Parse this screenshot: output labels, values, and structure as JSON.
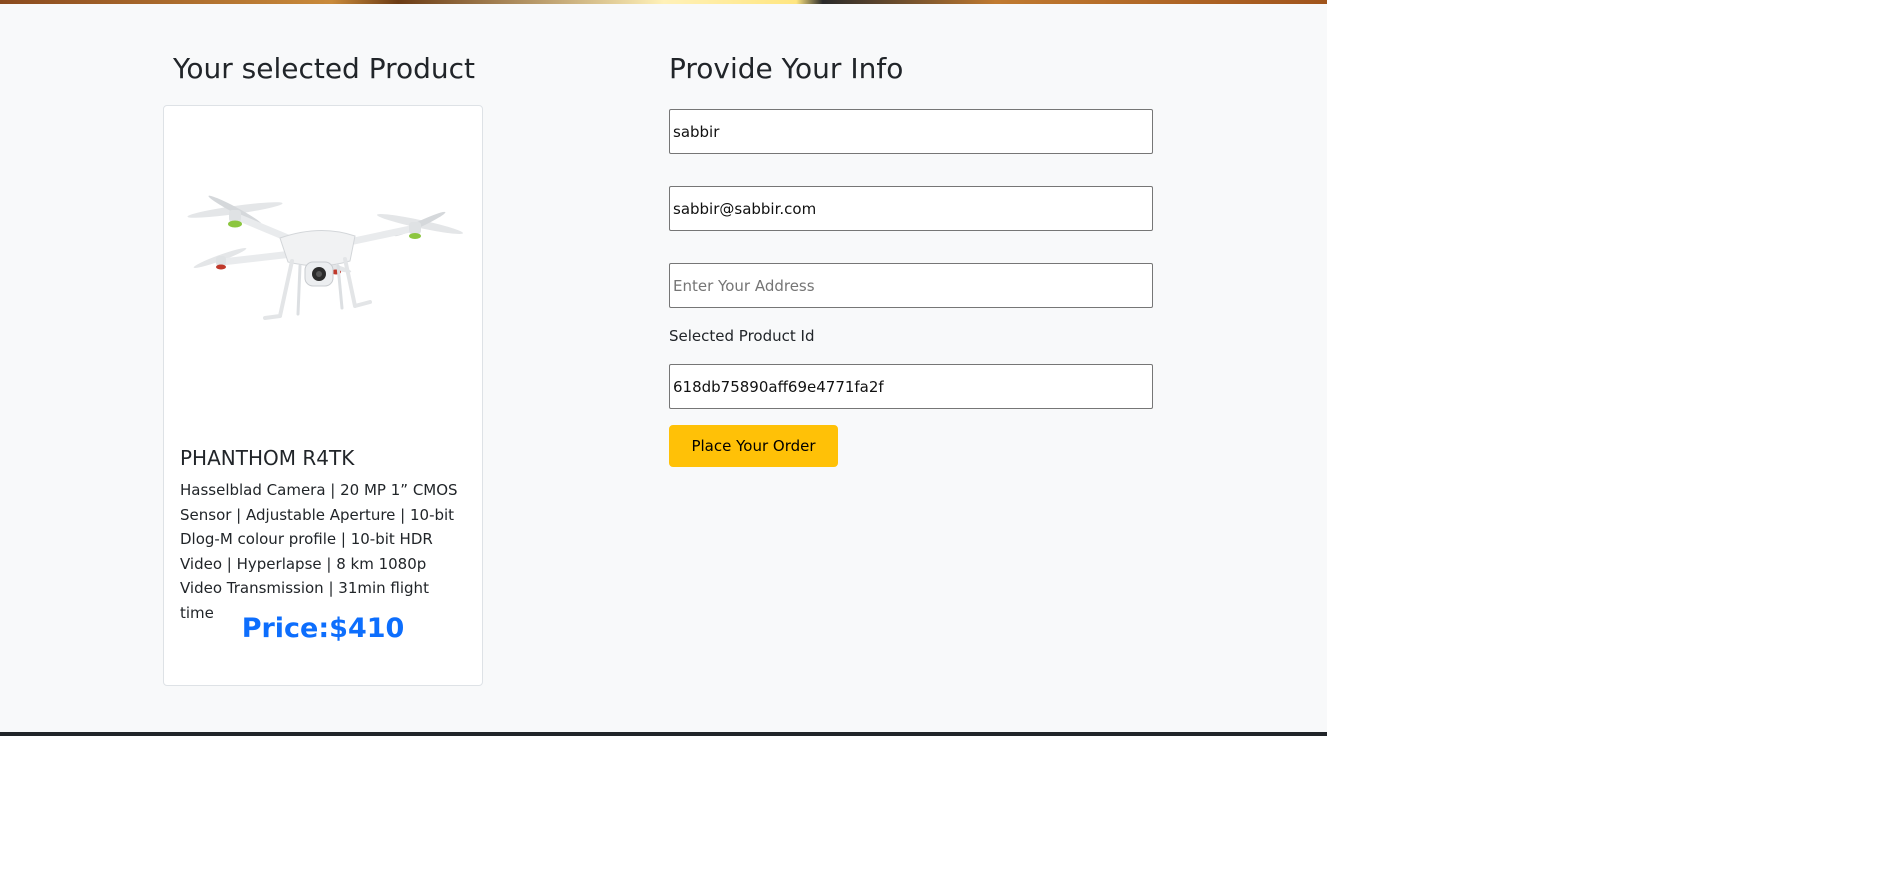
{
  "product_section": {
    "title": "Your selected Product",
    "product": {
      "image_icon": "drone-image",
      "name": "PHANTHOM R4TK",
      "description": "Hasselblad Camera | 20 MP 1” CMOS Sensor | Adjustable Aperture | 10-bit Dlog-M colour profile | 10-bit HDR Video | Hyperlapse | 8 km 1080p Video Transmission | 31min flight time",
      "price": "Price:$410"
    }
  },
  "info_section": {
    "title": "Provide Your Info",
    "name_field": {
      "value": "sabbir"
    },
    "email_field": {
      "value": "sabbir@sabbir.com"
    },
    "address_field": {
      "value": "",
      "placeholder": "Enter Your Address"
    },
    "product_id_label": "Selected Product Id",
    "product_id_field": {
      "value": "618db75890aff69e4771fa2f"
    },
    "submit_label": "Place Your Order"
  },
  "colors": {
    "price": "#0d6efd",
    "button": "#ffc107",
    "panel_bg": "#f8f9fa",
    "footer_line": "#212529"
  }
}
